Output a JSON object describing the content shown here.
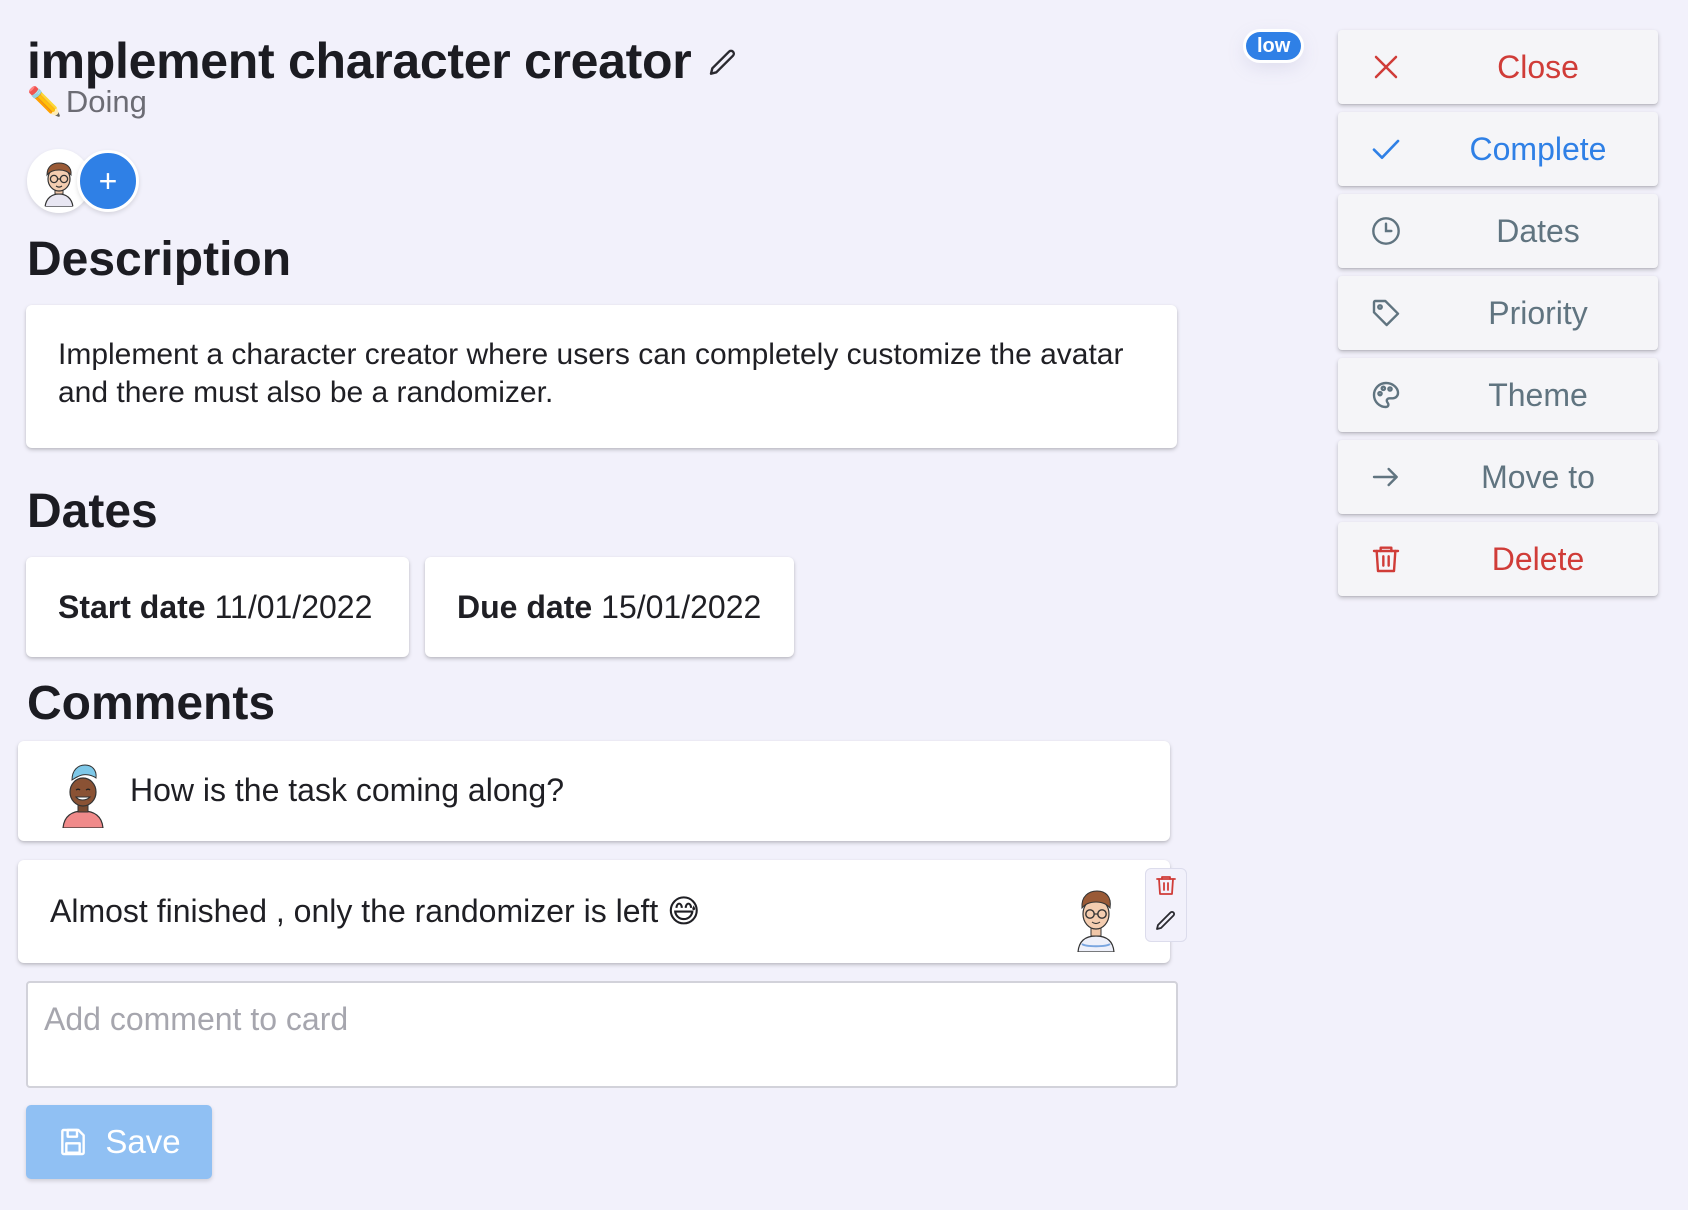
{
  "card": {
    "title": "implement character creator",
    "status_emoji": "✏️",
    "status": "Doing",
    "priority_badge": "low",
    "add_member_label": "+"
  },
  "sections": {
    "description_heading": "Description",
    "dates_heading": "Dates",
    "comments_heading": "Comments"
  },
  "description": {
    "text": "Implement a character creator where users can completely customize the avatar and there must also be a randomizer."
  },
  "dates": {
    "start_label": "Start date",
    "start_value": "11/01/2022",
    "due_label": "Due date",
    "due_value": "15/01/2022"
  },
  "comments": [
    {
      "text": "How is the task coming along?"
    },
    {
      "text": "Almost finished , only the randomizer is left 😅"
    }
  ],
  "comment_input": {
    "placeholder": "Add comment to card",
    "value": ""
  },
  "save_button": {
    "label": "Save"
  },
  "sidebar": {
    "items": [
      {
        "label": "Close",
        "icon": "close-icon",
        "color": "#d03c38"
      },
      {
        "label": "Complete",
        "icon": "check-icon",
        "color": "#2f80e6"
      },
      {
        "label": "Dates",
        "icon": "clock-icon",
        "color": "#607480"
      },
      {
        "label": "Priority",
        "icon": "tag-icon",
        "color": "#607480"
      },
      {
        "label": "Theme",
        "icon": "palette-icon",
        "color": "#607480"
      },
      {
        "label": "Move to",
        "icon": "arrow-right-icon",
        "color": "#607480"
      },
      {
        "label": "Delete",
        "icon": "trash-icon",
        "color": "#d03c38"
      }
    ]
  },
  "colors": {
    "background": "#f2f1fb",
    "accent": "#2f80e6",
    "danger": "#d03c38",
    "muted": "#607480",
    "save_button": "#90c0f3"
  }
}
